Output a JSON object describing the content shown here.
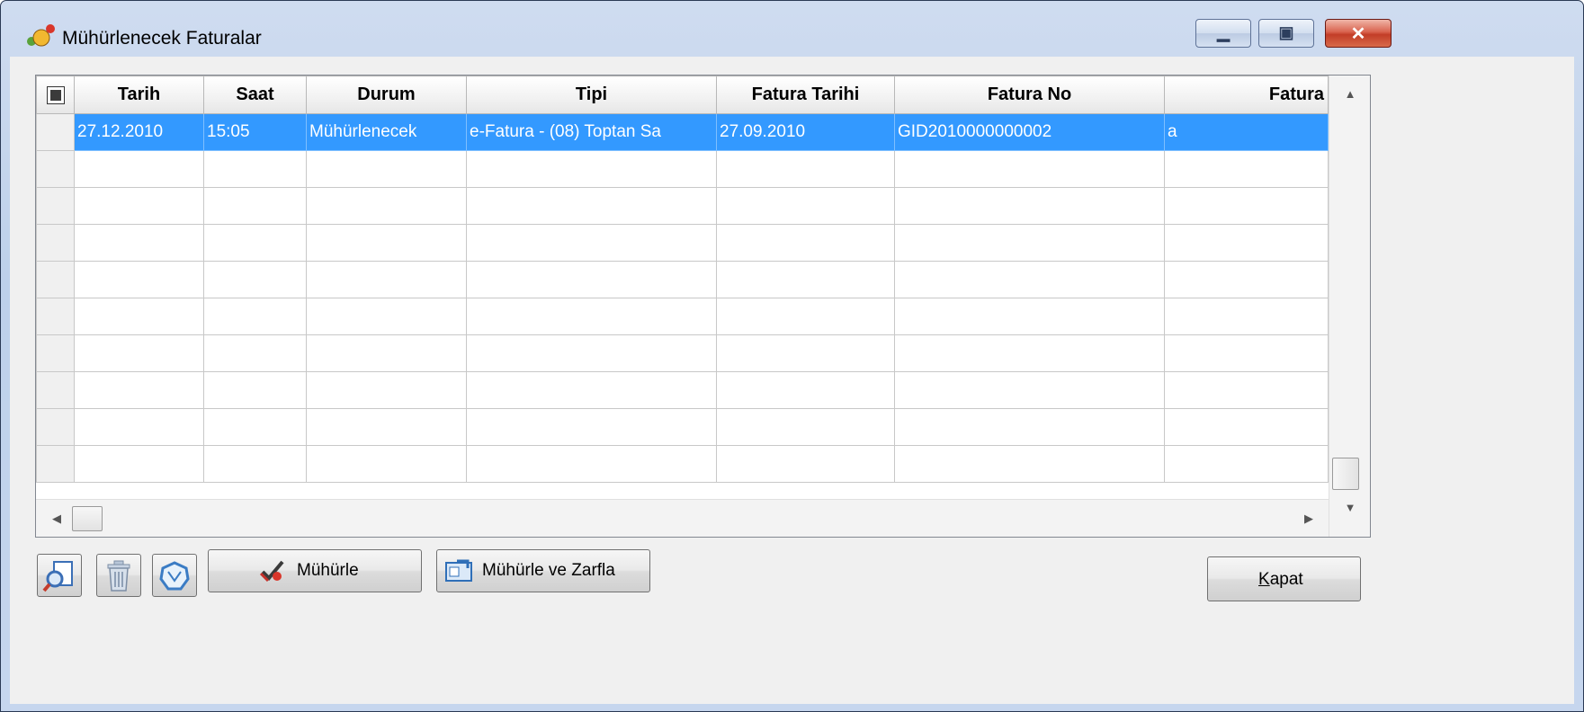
{
  "window": {
    "title": "Mühürlenecek Faturalar",
    "controls": {
      "minimize": "minimize-icon",
      "maximize": "maximize-icon",
      "close": "close-icon"
    }
  },
  "grid": {
    "columns": [
      "Tarih",
      "Saat",
      "Durum",
      "Tipi",
      "Fatura Tarihi",
      "Fatura No",
      "Fatura"
    ],
    "rows": [
      {
        "tarih": "27.12.2010",
        "saat": "15:05",
        "durum": "Mühürlenecek",
        "tipi": "e-Fatura - (08) Toptan Sa",
        "fatura_tarihi": "27.09.2010",
        "fatura_no": "GID2010000000002",
        "fatura": "a",
        "selected": true
      }
    ],
    "empty_rows": 9
  },
  "toolbar": {
    "preview_icon": "preview-magnifier-icon",
    "delete_icon": "trash-icon",
    "seal_icon": "seal-icon",
    "muhurle_label": "Mühürle",
    "muhurle_zarfla_label": "Mühürle ve Zarfla"
  },
  "footer": {
    "close_label_underlined": "K",
    "close_label_rest": "apat"
  },
  "colors": {
    "selection": "#3399ff",
    "titlebar": "#bdd0ea",
    "close_button": "#c23d27"
  }
}
